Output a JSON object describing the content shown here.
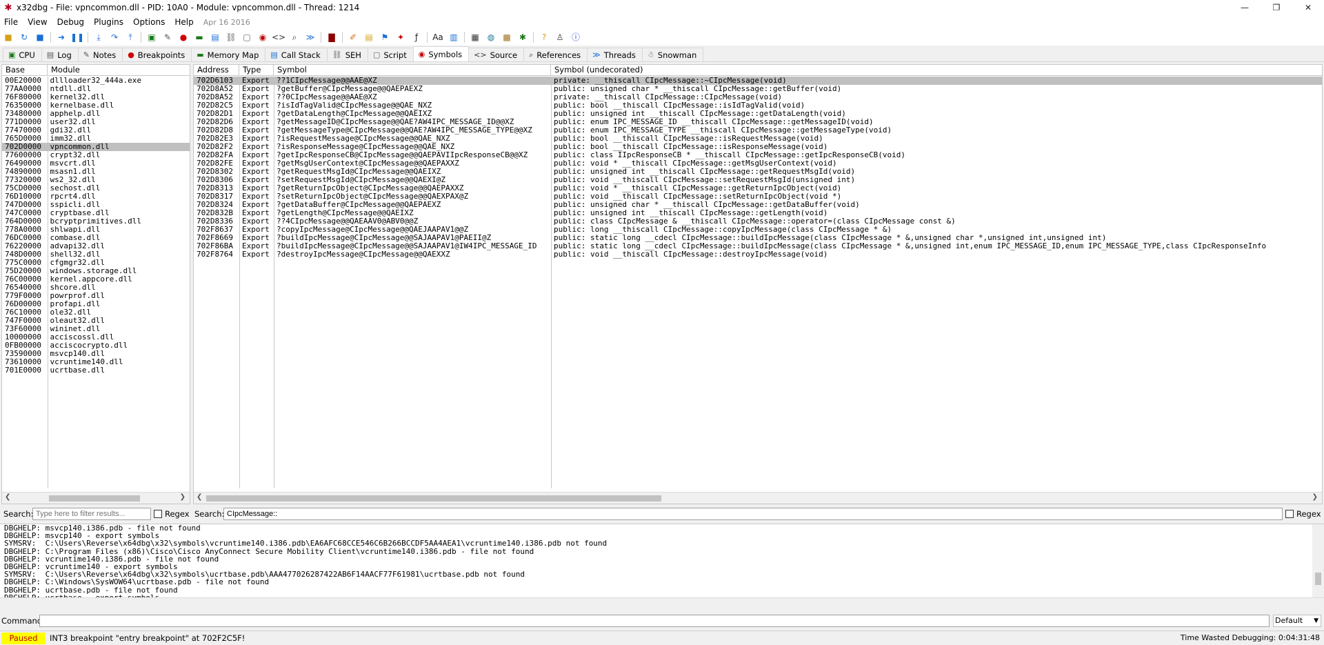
{
  "window": {
    "title": "x32dbg - File: vpncommon.dll - PID: 10A0 - Module: vpncommon.dll - Thread: 1214",
    "app_icon": "bug-icon",
    "minimize": "—",
    "maximize": "❐",
    "close": "✕"
  },
  "menu": {
    "items": [
      "File",
      "View",
      "Debug",
      "Plugins",
      "Options",
      "Help"
    ],
    "date": "Apr 16 2016"
  },
  "tabs": [
    {
      "label": "CPU",
      "icon": "cpu-icon"
    },
    {
      "label": "Log",
      "icon": "log-icon"
    },
    {
      "label": "Notes",
      "icon": "notes-icon"
    },
    {
      "label": "Breakpoints",
      "icon": "breakpoint-icon"
    },
    {
      "label": "Memory Map",
      "icon": "memory-icon"
    },
    {
      "label": "Call Stack",
      "icon": "callstack-icon"
    },
    {
      "label": "SEH",
      "icon": "seh-icon"
    },
    {
      "label": "Script",
      "icon": "script-icon"
    },
    {
      "label": "Symbols",
      "icon": "symbols-icon",
      "active": true
    },
    {
      "label": "Source",
      "icon": "source-icon"
    },
    {
      "label": "References",
      "icon": "references-icon"
    },
    {
      "label": "Threads",
      "icon": "threads-icon"
    },
    {
      "label": "Snowman",
      "icon": "snowman-icon"
    }
  ],
  "modules": {
    "headers": [
      "Base",
      "Module"
    ],
    "rows": [
      [
        "00E20000",
        "dllloader32_444a.exe"
      ],
      [
        "77AA0000",
        "ntdll.dll"
      ],
      [
        "76F80000",
        "kernel32.dll"
      ],
      [
        "76350000",
        "kernelbase.dll"
      ],
      [
        "73480000",
        "apphelp.dll"
      ],
      [
        "771D0000",
        "user32.dll"
      ],
      [
        "77470000",
        "gdi32.dll"
      ],
      [
        "765D0000",
        "imm32.dll"
      ],
      [
        "702D0000",
        "vpncommon.dll"
      ],
      [
        "77600000",
        "crypt32.dll"
      ],
      [
        "76490000",
        "msvcrt.dll"
      ],
      [
        "74890000",
        "msasn1.dll"
      ],
      [
        "77320000",
        "ws2_32.dll"
      ],
      [
        "75CD0000",
        "sechost.dll"
      ],
      [
        "76D10000",
        "rpcrt4.dll"
      ],
      [
        "747D0000",
        "sspicli.dll"
      ],
      [
        "747C0000",
        "cryptbase.dll"
      ],
      [
        "764D0000",
        "bcryptprimitives.dll"
      ],
      [
        "778A0000",
        "shlwapi.dll"
      ],
      [
        "76DC0000",
        "combase.dll"
      ],
      [
        "76220000",
        "advapi32.dll"
      ],
      [
        "748D0000",
        "shell32.dll"
      ],
      [
        "775C0000",
        "cfgmgr32.dll"
      ],
      [
        "75D20000",
        "windows.storage.dll"
      ],
      [
        "76C00000",
        "kernel.appcore.dll"
      ],
      [
        "76540000",
        "shcore.dll"
      ],
      [
        "779F0000",
        "powrprof.dll"
      ],
      [
        "76D00000",
        "profapi.dll"
      ],
      [
        "76C10000",
        "ole32.dll"
      ],
      [
        "747F0000",
        "oleaut32.dll"
      ],
      [
        "73F60000",
        "wininet.dll"
      ],
      [
        "10000000",
        "acciscossl.dll"
      ],
      [
        "0FB00000",
        "acciscocrypto.dll"
      ],
      [
        "73590000",
        "msvcp140.dll"
      ],
      [
        "73610000",
        "vcruntime140.dll"
      ],
      [
        "701E0000",
        "ucrtbase.dll"
      ]
    ],
    "selected": 8
  },
  "symbols": {
    "headers": [
      "Address",
      "Type",
      "Symbol",
      "Symbol (undecorated)"
    ],
    "rows": [
      [
        "702D6103",
        "Export",
        "??1CIpcMessage@@AAE@XZ",
        "private: __thiscall ",
        "CIpcMessage::",
        "~CIpcMessage(void)"
      ],
      [
        "702D8A52",
        "Export",
        "?getBuffer@CIpcMessage@@QAEPAEXZ",
        "public: unsigned char * __thiscall ",
        "CIpcMessage::",
        "getBuffer(void)"
      ],
      [
        "702D8A52",
        "Export",
        "??0CIpcMessage@@AAE@XZ",
        "private: __thiscall ",
        "CIpcMessage::",
        "CIpcMessage(void)"
      ],
      [
        "702D82C5",
        "Export",
        "?isIdTagValid@CIpcMessage@@QAE_NXZ",
        "public: bool __thiscall ",
        "CIpcMessage::",
        "isIdTagValid(void)"
      ],
      [
        "702D82D1",
        "Export",
        "?getDataLength@CIpcMessage@@QAEIXZ",
        "public: unsigned int __thiscall ",
        "CIpcMessage::",
        "getDataLength(void)"
      ],
      [
        "702D82D6",
        "Export",
        "?getMessageID@CIpcMessage@@QAE?AW4IPC_MESSAGE_ID@@XZ",
        "public: enum IPC_MESSAGE_ID __thiscall ",
        "CIpcMessage::",
        "getMessageID(void)"
      ],
      [
        "702D82D8",
        "Export",
        "?getMessageType@CIpcMessage@@QAE?AW4IPC_MESSAGE_TYPE@@XZ",
        "public: enum IPC_MESSAGE_TYPE __thiscall ",
        "CIpcMessage::",
        "getMessageType(void)"
      ],
      [
        "702D82E3",
        "Export",
        "?isRequestMessage@CIpcMessage@@QAE_NXZ",
        "public: bool __thiscall ",
        "CIpcMessage::",
        "isRequestMessage(void)"
      ],
      [
        "702D82F2",
        "Export",
        "?isResponseMessage@CIpcMessage@@QAE_NXZ",
        "public: bool __thiscall ",
        "CIpcMessage::",
        "isResponseMessage(void)"
      ],
      [
        "702D82FA",
        "Export",
        "?getIpcResponseCB@CIpcMessage@@QAEPAVIIpcResponseCB@@XZ",
        "public: class IIpcResponseCB * __thiscall ",
        "CIpcMessage::",
        "getIpcResponseCB(void)"
      ],
      [
        "702D82FE",
        "Export",
        "?getMsgUserContext@CIpcMessage@@QAEPAXXZ",
        "public: void * __thiscall ",
        "CIpcMessage::",
        "getMsgUserContext(void)"
      ],
      [
        "702D8302",
        "Export",
        "?getRequestMsgId@CIpcMessage@@QAEIXZ",
        "public: unsigned int __thiscall ",
        "CIpcMessage::",
        "getRequestMsgId(void)"
      ],
      [
        "702D8306",
        "Export",
        "?setRequestMsgId@CIpcMessage@@QAEXI@Z",
        "public: void __thiscall ",
        "CIpcMessage::",
        "setRequestMsgId(unsigned int)"
      ],
      [
        "702D8313",
        "Export",
        "?getReturnIpcObject@CIpcMessage@@QAEPAXXZ",
        "public: void * __thiscall ",
        "CIpcMessage::",
        "getReturnIpcObject(void)"
      ],
      [
        "702D8317",
        "Export",
        "?setReturnIpcObject@CIpcMessage@@QAEXPAX@Z",
        "public: void __thiscall ",
        "CIpcMessage::",
        "setReturnIpcObject(void *)"
      ],
      [
        "702D8324",
        "Export",
        "?getDataBuffer@CIpcMessage@@QAEPAEXZ",
        "public: unsigned char * __thiscall ",
        "CIpcMessage::",
        "getDataBuffer(void)"
      ],
      [
        "702D832B",
        "Export",
        "?getLength@CIpcMessage@@QAEIXZ",
        "public: unsigned int __thiscall ",
        "CIpcMessage::",
        "getLength(void)"
      ],
      [
        "702D8336",
        "Export",
        "??4CIpcMessage@@QAEAAV0@ABV0@@Z",
        "public: class CIpcMessage & __thiscall ",
        "CIpcMessage::",
        "operator=(class CIpcMessage const &)"
      ],
      [
        "702F8637",
        "Export",
        "?copyIpcMessage@CIpcMessage@@QAEJAAPAV1@@Z",
        "public: long __thiscall ",
        "CIpcMessage::",
        "copyIpcMessage(class CIpcMessage * &)"
      ],
      [
        "702F8669",
        "Export",
        "?buildIpcMessage@CIpcMessage@@SAJAAPAV1@PAEII@Z",
        "public: static long __cdecl ",
        "CIpcMessage::",
        "buildIpcMessage(class CIpcMessage * &,unsigned char *,unsigned int,unsigned int)"
      ],
      [
        "702F86BA",
        "Export",
        "?buildIpcMessage@CIpcMessage@@SAJAAPAV1@IW4IPC_MESSAGE_ID",
        "public: static long __cdecl ",
        "CIpcMessage::",
        "buildIpcMessage(class CIpcMessage * &,unsigned int,enum IPC_MESSAGE_ID,enum IPC_MESSAGE_TYPE,class CIpcResponseInfo"
      ],
      [
        "702F8764",
        "Export",
        "?destroyIpcMessage@CIpcMessage@@QAEXXZ",
        "public: void __thiscall ",
        "CIpcMessage::",
        "destroyIpcMessage(void)"
      ]
    ],
    "selected": 0
  },
  "search": {
    "label1": "Search:",
    "placeholder1": "Type here to filter results...",
    "regex1": "Regex",
    "label2": "Search:",
    "value2": "CIpcMessage::",
    "regex2": "Regex"
  },
  "log": {
    "lines": [
      "DBGHELP: msvcp140.i386.pdb - file not found",
      "DBGHELP: msvcp140 - export symbols",
      "SYMSRV:  C:\\Users\\Reverse\\x64dbg\\x32\\symbols\\vcruntime140.i386.pdb\\EA6AFC68CCE546C6B266BCCDF5AA4AEA1\\vcruntime140.i386.pdb not found",
      "DBGHELP: C:\\Program Files (x86)\\Cisco\\Cisco AnyConnect Secure Mobility Client\\vcruntime140.i386.pdb - file not found",
      "DBGHELP: vcruntime140.i386.pdb - file not found",
      "DBGHELP: vcruntime140 - export symbols",
      "SYMSRV:  C:\\Users\\Reverse\\x64dbg\\x32\\symbols\\ucrtbase.pdb\\AAA477026287422AB6F14AACF77F61981\\ucrtbase.pdb not found",
      "DBGHELP: C:\\Windows\\SysWOW64\\ucrtbase.pdb - file not found",
      "DBGHELP: ucrtbase.pdb - file not found",
      "DBGHELP: ucrtbase - export symbols"
    ]
  },
  "command": {
    "label": "Command:",
    "value": "",
    "dropdown": "Default"
  },
  "status": {
    "state": "Paused",
    "message": "INT3 breakpoint \"entry breakpoint\" at 702F2C5F!",
    "time_wasted": "Time Wasted Debugging: 0:04:31:48"
  }
}
